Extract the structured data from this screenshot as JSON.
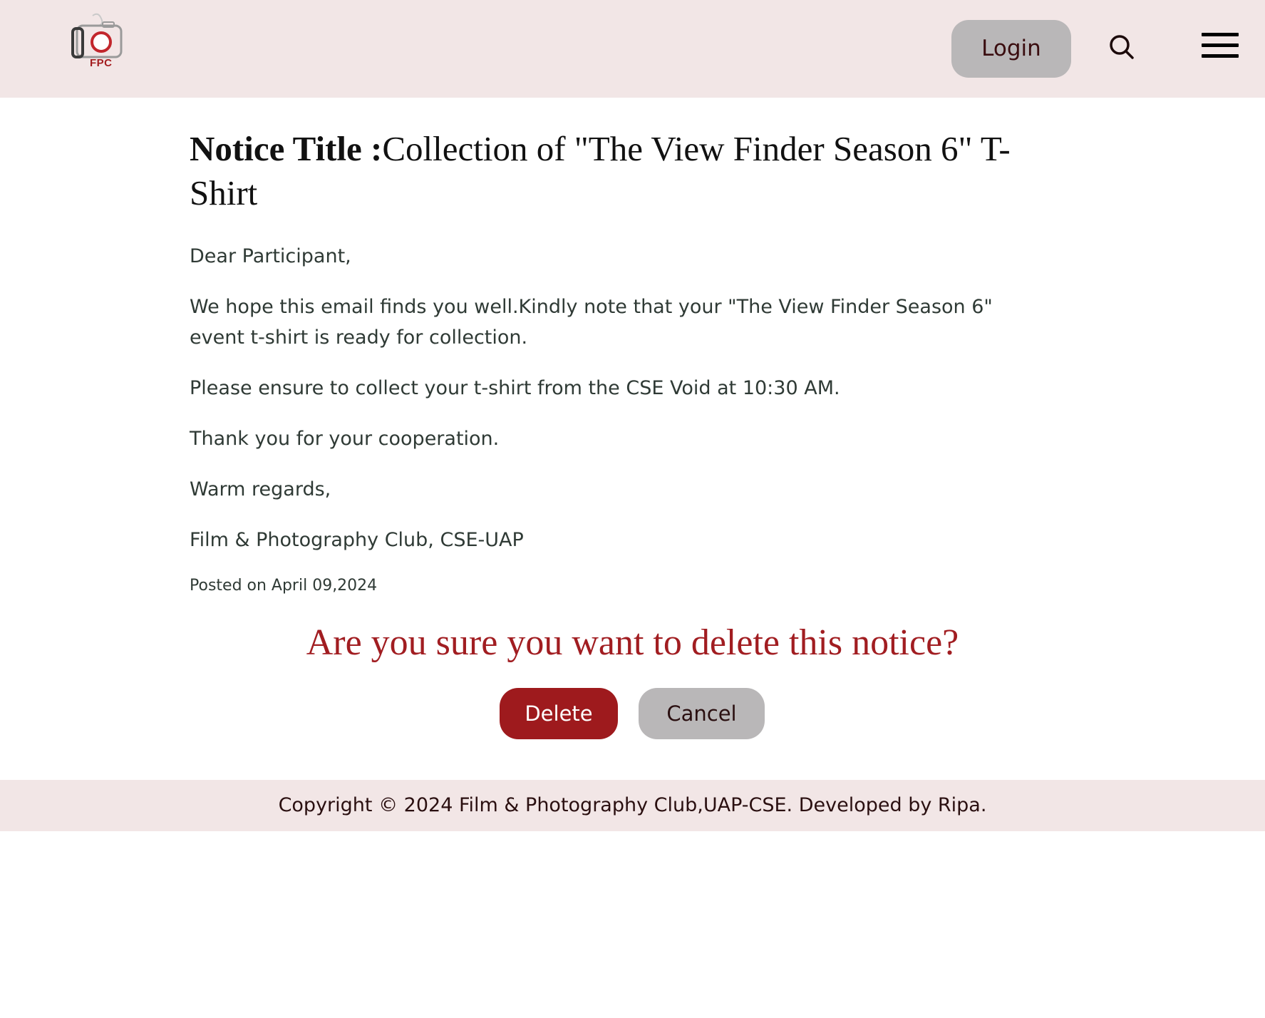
{
  "header": {
    "logo_text": "FPC",
    "login_label": "Login",
    "icons": [
      "camera-logo-icon",
      "search-icon",
      "hamburger-menu-icon"
    ]
  },
  "notice": {
    "title_label": "Notice Title :",
    "title_text": "Collection of \"The View Finder Season 6\" T-Shirt",
    "paragraphs": [
      "Dear Participant,",
      "We hope this email finds you well.Kindly note that your \"The View Finder Season 6\" event t-shirt is ready for collection.",
      "Please ensure to collect your t-shirt from the CSE Void at 10:30 AM.",
      "Thank you for your cooperation.",
      "Warm regards,",
      "Film & Photography Club, CSE-UAP"
    ],
    "posted": "Posted on April 09,2024"
  },
  "confirm": {
    "question": "Are you sure you want to delete this notice?",
    "delete_label": "Delete",
    "cancel_label": "Cancel"
  },
  "footer": {
    "copyright": "Copyright © 2024 Film & Photography Club,UAP-CSE. Developed by Ripa."
  },
  "colors": {
    "header_bg": "#f2e6e6",
    "accent_red": "#9e1a1d",
    "button_gray": "#b9b7b8"
  }
}
